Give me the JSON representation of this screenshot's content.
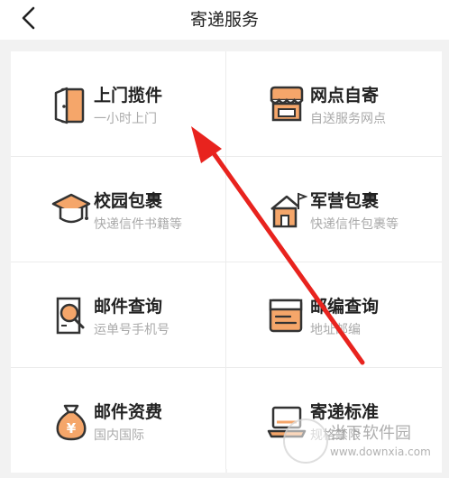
{
  "header": {
    "title": "寄递服务",
    "back_icon": "chevron-left-icon"
  },
  "services": [
    {
      "label": "上门揽件",
      "sub": "一小时上门",
      "icon": "door-icon"
    },
    {
      "label": "网点自寄",
      "sub": "自送服务网点",
      "icon": "shop-icon"
    },
    {
      "label": "校园包裹",
      "sub": "快递信件书籍等",
      "icon": "graduation-cap-icon"
    },
    {
      "label": "军营包裹",
      "sub": "快递信件包裹等",
      "icon": "barracks-icon"
    },
    {
      "label": "邮件查询",
      "sub": "运单号手机号",
      "icon": "document-search-icon"
    },
    {
      "label": "邮编查询",
      "sub": "地址邮编",
      "icon": "postcode-icon"
    },
    {
      "label": "邮件资费",
      "sub": "国内国际",
      "icon": "money-bag-icon"
    },
    {
      "label": "寄递标准",
      "sub": "规格禁限",
      "icon": "laptop-ruler-icon"
    }
  ],
  "colors": {
    "accent": "#f5a66a",
    "outline": "#333333",
    "annotation_arrow": "#e8231e"
  },
  "watermark": {
    "brand": "当下软件园",
    "url": "www.downxia.com"
  }
}
